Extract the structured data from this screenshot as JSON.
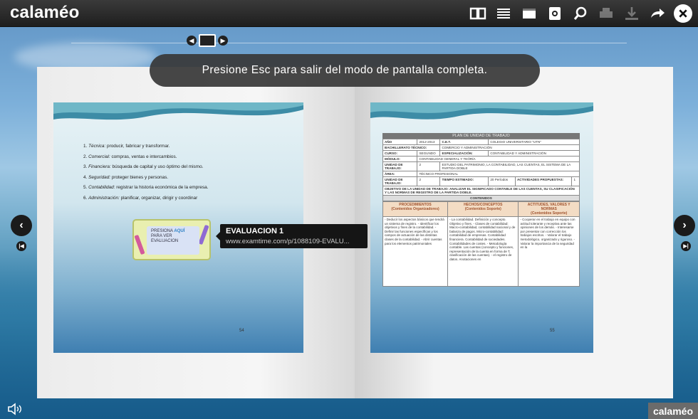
{
  "app": {
    "logo": "calaméo",
    "brand_badge": "calaméo"
  },
  "toolbar": {
    "icons": [
      "book-icon",
      "list-icon",
      "fullscreen-icon",
      "document-icon",
      "zoom-icon",
      "print-icon",
      "download-icon",
      "share-icon",
      "close-icon"
    ]
  },
  "notice": "Presione Esc para salir del modo de pantalla completa.",
  "left_page": {
    "list": [
      {
        "term": "Técnica:",
        "text": "producir, fabricar y transformar."
      },
      {
        "term": "Comercial:",
        "text": "compras, ventas e intercambios."
      },
      {
        "term": "Financiera:",
        "text": "búsqueda de capital y uso óptimo del mismo."
      },
      {
        "term": "Seguridad:",
        "text": "proteger bienes y personas."
      },
      {
        "term": "Contabilidad:",
        "text": "registrar la historia económica de la empresa."
      },
      {
        "term": "Administración:",
        "text": "planificar, organizar, dirigir y coordinar"
      }
    ],
    "card": {
      "line1": "PRESIONA",
      "accent": "AQUÍ",
      "line2": "PARA VER",
      "line3": "EVALUACION"
    },
    "page_number": "54"
  },
  "tooltip": {
    "title": "EVALUACION 1",
    "url": "www.examtime.com/p/1088109-EVALU..."
  },
  "right_page": {
    "table_title": "PLAN DE UNIDAD DE TRABAJO",
    "rows": {
      "anio_label": "AÑO",
      "anio_value": "2012-2013",
      "cet_label": "C.E.T.",
      "cet_value": "COLEGIO UNIVERSITARIO \"UTN\"",
      "bach_label": "BACHILLERATO TÉCNICO:",
      "bach_value": "COMERCIO Y ADMINISTRACIÓN",
      "curso_label": "CURSO:",
      "curso_value": "SEGUNDO",
      "esp_label": "ESPECIALIZACIÓN:",
      "esp_value": "CONTABILIDAD Y ADMINISTRACIÓN",
      "modulo_label": "MÓDULO:",
      "modulo_value": "CONTABILIDAD GENERAL Y TEÓRÍA",
      "unidad_label": "UNIDAD DE TRABAJO:",
      "unidad_num": "2",
      "unidad_value": "ESTUDIO DEL PATRIMONIO, LA CONTABILIDAD, LAS CUENTAS, EL SISTEMA DE LA PARTIDA DOBLE",
      "area_label": "ÁREA:",
      "area_value": "TÉCNICO PROFESIONAL",
      "ut_label": "UNIDAD DE TRABAJO:",
      "ut_num": "2",
      "tiempo_label": "TIEMPO ESTIMADO:",
      "tiempo_value": "20 Períodos",
      "act_label": "ACTIVIDADES PROPUESTAS:",
      "act_value": "1",
      "objetivo": "OBJETIVO DE LA UNIDAD DE TRABAJO: ANALIZAR EL SIGNIFICADO CONTABLE DE LAS CUENTAS, SU CLASIFICACIÓN Y LAS NORMAS DE REGISTRO DE LA PARTIDA DOBLE.",
      "contenidos": "CONTENIDOS"
    },
    "columns": [
      {
        "title": "PROCEDIMIENTOS",
        "sub": "(Contenidos Organizadores)"
      },
      {
        "title": "HECHOS/CONCEPTOS",
        "sub": "(Contenidos Soporte)"
      },
      {
        "title": "ACTITUDES, VALORES Y NORMAS",
        "sub": "(Contenidos Soporte)"
      }
    ],
    "col_text": [
      "- Deducir los aspectos básicos que tendrá un sistema de registro.\n- Identificar los objetivos y fines de la contabilidad.\n- Definir las funciones específicas y los campos de actuación de las distintas clases de la contabilidad.\n- Abrir cuentas para los elementos patrimoniales",
      "- La contabilidad. Definición y concepto. Objetivo y fines.\n- Clases de contabilidad: Macro-contabilidad, contabilidad nacional y de balanza de pagos. Micro-contabilidad: contabilidad de empresas. Contabilidad financiera. Contabilidad de sociedades. Contabilidades de costes.\n- Metodología contable. Las cuentas (concepto y funciones, representación de la cuenta en forma de T, clasificación de las cuentas).\n- el registro de datos. Anotaciones en",
      "- Cooperar en el trabajo en equipo con actitud tolerante y receptiva ante las opiniones de los demás.\n- Interesarse por presentar con corrección los trabajos escritos.\n- Valorar el trabajo metodológico, organizado y riguroso.\n- Valorar la importancia de la seguridad en la"
    ],
    "page_number": "55"
  }
}
